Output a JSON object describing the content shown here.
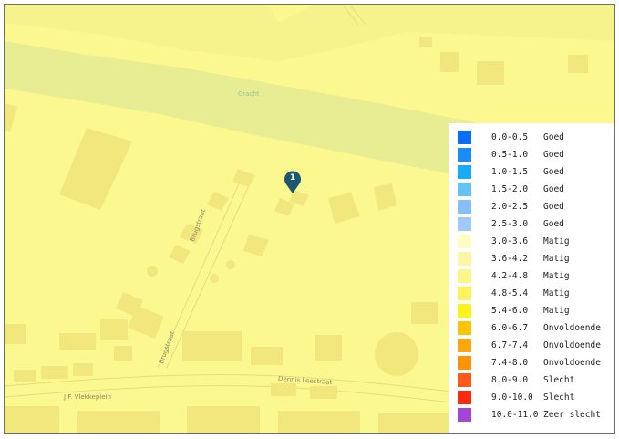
{
  "map": {
    "water_label": "Gracht",
    "street_labels": {
      "brugstraat_upper": "Brugstraat",
      "brugstraat_lower": "Brugstraat",
      "dennis_leestraat": "Dennis Leestraat",
      "jf_vlekkeplein": "J.F. Vlekkeplein"
    },
    "marker_number": "1",
    "colors": {
      "background": "#fcf890",
      "building": "#f0e67a",
      "canal": "#e6ec8f",
      "road_edge": "#ddd77a",
      "marker": "#1e5670"
    }
  },
  "legend": {
    "items": [
      {
        "range": "0.0-0.5",
        "label": "Goed",
        "color": "#0a6ef5"
      },
      {
        "range": "0.5-1.0",
        "label": "Goed",
        "color": "#1a8cf5"
      },
      {
        "range": "1.0-1.5",
        "label": "Goed",
        "color": "#18acf7"
      },
      {
        "range": "1.5-2.0",
        "label": "Goed",
        "color": "#63c3f8"
      },
      {
        "range": "2.0-2.5",
        "label": "Goed",
        "color": "#86c0f6"
      },
      {
        "range": "2.5-3.0",
        "label": "Goed",
        "color": "#a0c8fa"
      },
      {
        "range": "3.0-3.6",
        "label": "Matig",
        "color": "#fefcc5"
      },
      {
        "range": "3.6-4.2",
        "label": "Matig",
        "color": "#fdf7a5"
      },
      {
        "range": "4.2-4.8",
        "label": "Matig",
        "color": "#fdf688"
      },
      {
        "range": "4.8-5.4",
        "label": "Matig",
        "color": "#fcf35d"
      },
      {
        "range": "5.4-6.0",
        "label": "Matig",
        "color": "#fcf418"
      },
      {
        "range": "6.0-6.7",
        "label": "Onvoldoende",
        "color": "#fdc309"
      },
      {
        "range": "6.7-7.4",
        "label": "Onvoldoende",
        "color": "#fda70c"
      },
      {
        "range": "7.4-8.0",
        "label": "Onvoldoende",
        "color": "#fd9408"
      },
      {
        "range": "8.0-9.0",
        "label": "Slecht",
        "color": "#fc5a19"
      },
      {
        "range": "9.0-10.0",
        "label": "Slecht",
        "color": "#fc2a0e"
      },
      {
        "range": "10.0-11.0",
        "label": "Zeer slecht",
        "color": "#a445d8"
      }
    ]
  }
}
